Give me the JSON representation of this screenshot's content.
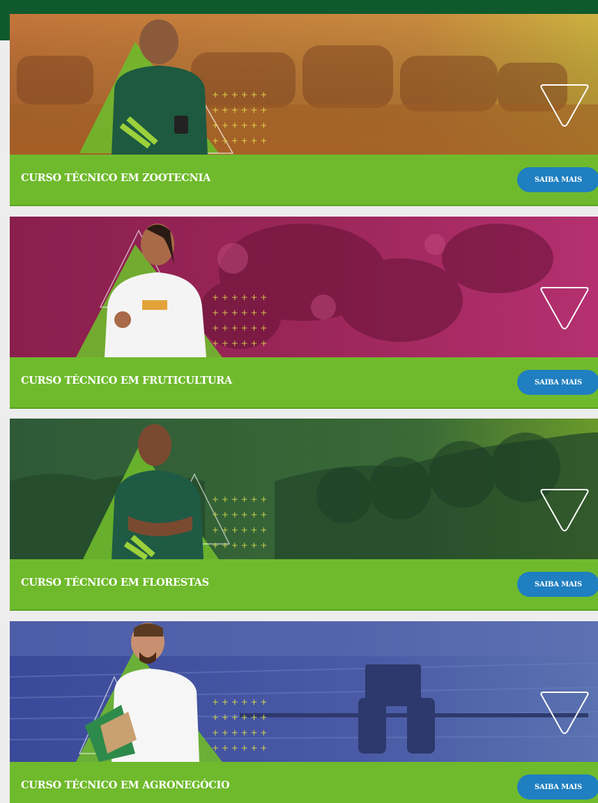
{
  "courses": [
    {
      "title": "CURSO TÉCNICO EM ZOOTECNIA",
      "button": "SAIBA MAIS",
      "theme": "orange",
      "bg_color": "#c97b3a",
      "bg_color_light": "#e0b35a"
    },
    {
      "title": "CURSO TÉCNICO EM FRUTICULTURA",
      "button": "SAIBA MAIS",
      "theme": "magenta",
      "bg_color": "#8a1f52",
      "bg_color_light": "#b22a6a"
    },
    {
      "title": "CURSO TÉCNICO EM FLORESTAS",
      "button": "SAIBA MAIS",
      "theme": "green",
      "bg_color": "#2f5a34",
      "bg_color_light": "#5b8a2a"
    },
    {
      "title": "CURSO TÉCNICO EM AGRONEGÓCIO",
      "button": "SAIBA MAIS",
      "theme": "blue",
      "bg_color": "#3d4a9a",
      "bg_color_light": "#5a76b6"
    }
  ],
  "colors": {
    "header": "#0f5a2c",
    "bar": "#6fba2c",
    "button": "#1f7fc0",
    "page_bg": "#ededed"
  }
}
